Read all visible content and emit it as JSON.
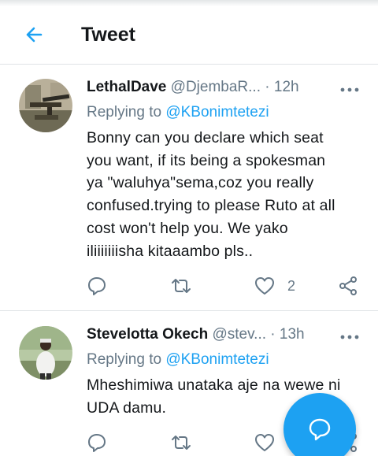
{
  "header": {
    "title": "Tweet"
  },
  "tweets": [
    {
      "name": "LethalDave",
      "handle": "@DjembaR...",
      "time": "· 12h",
      "replying_prefix": "Replying to ",
      "replying_handle": "@KBonimtetezi",
      "lines": [
        "Bonny can you declare which seat",
        "you want, if its being a spokesman",
        "ya \"waluhya\"sema,coz you really",
        "confused.trying to please Ruto at all",
        "cost won't help you. We yako",
        "iliiiiiiisha kitaaambo pls.."
      ],
      "like_count": "2"
    },
    {
      "name": "Stevelotta Okech",
      "handle": "@stev...",
      "time": "· 13h",
      "replying_prefix": "Replying to ",
      "replying_handle": "@KBonimtetezi",
      "lines": [
        "Mheshimiwa unataka aje na wewe ni",
        "UDA damu."
      ],
      "like_count": ""
    }
  ],
  "icons": {
    "back": "arrow-left-icon",
    "more": "more-dots-icon",
    "reply": "comment-bubble-icon",
    "retweet": "retweet-icon",
    "like": "heart-icon",
    "share": "share-icon",
    "compose": "compose-reply-icon"
  },
  "colors": {
    "accent": "#1da1f2",
    "text": "#14171a",
    "muted": "#657786",
    "divider": "#dfe3e6"
  }
}
